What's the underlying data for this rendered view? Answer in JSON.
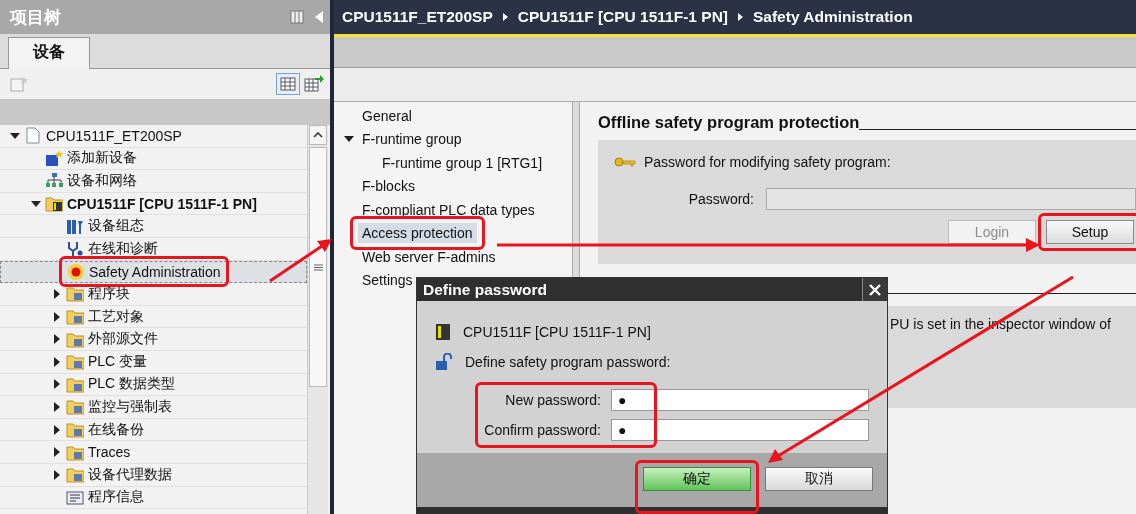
{
  "project_tree": {
    "title": "项目树",
    "tabs": [
      {
        "label": "设备",
        "selected": true
      }
    ],
    "items": [
      {
        "label": "CPU1511F_ET200SP",
        "kind": "project",
        "expanded": true,
        "selected": false,
        "highlighted": false,
        "children": [
          {
            "label": "添加新设备",
            "kind": "add",
            "selected": false,
            "highlighted": false
          },
          {
            "label": "设备和网络",
            "kind": "network",
            "selected": false,
            "highlighted": false
          },
          {
            "label": "CPU1511F [CPU 1511F-1 PN]",
            "kind": "plc",
            "bold": true,
            "expanded": true,
            "selected": false,
            "highlighted": false,
            "children": [
              {
                "label": "设备组态",
                "kind": "config",
                "selected": false,
                "highlighted": false
              },
              {
                "label": "在线和诊断",
                "kind": "diag",
                "selected": false,
                "highlighted": false
              },
              {
                "label": "Safety Administration",
                "kind": "safety",
                "selected": true,
                "highlighted": true
              },
              {
                "label": "程序块",
                "kind": "folder",
                "expanded": false,
                "selected": false,
                "highlighted": false
              },
              {
                "label": "工艺对象",
                "kind": "folder",
                "expanded": false,
                "selected": false,
                "highlighted": false
              },
              {
                "label": "外部源文件",
                "kind": "folder",
                "expanded": false,
                "selected": false,
                "highlighted": false
              },
              {
                "label": "PLC 变量",
                "kind": "folder",
                "expanded": false,
                "selected": false,
                "highlighted": false
              },
              {
                "label": "PLC 数据类型",
                "kind": "folder",
                "expanded": false,
                "selected": false,
                "highlighted": false
              },
              {
                "label": "监控与强制表",
                "kind": "folder",
                "expanded": false,
                "selected": false,
                "highlighted": false
              },
              {
                "label": "在线备份",
                "kind": "folder",
                "expanded": false,
                "selected": false,
                "highlighted": false
              },
              {
                "label": "Traces",
                "kind": "folder",
                "expanded": false,
                "selected": false,
                "highlighted": false
              },
              {
                "label": "设备代理数据",
                "kind": "folder",
                "expanded": false,
                "selected": false,
                "highlighted": false
              },
              {
                "label": "程序信息",
                "kind": "info",
                "selected": false,
                "highlighted": false
              }
            ]
          }
        ]
      }
    ]
  },
  "breadcrumb": [
    "CPU1511F_ET200SP",
    "CPU1511F [CPU 1511F-1 PN]",
    "Safety Administration"
  ],
  "nav": [
    {
      "label": "General",
      "selected": false,
      "highlighted": false
    },
    {
      "label": "F-runtime group",
      "expanded": true,
      "selected": false,
      "highlighted": false,
      "children": [
        {
          "label": "F-runtime group 1 [RTG1]",
          "selected": false,
          "highlighted": false
        }
      ]
    },
    {
      "label": "F-blocks",
      "selected": false,
      "highlighted": false
    },
    {
      "label": "F-compliant PLC data types",
      "selected": false,
      "highlighted": false
    },
    {
      "label": "Access protection",
      "selected": true,
      "highlighted": true
    },
    {
      "label": "Web server F-admins",
      "selected": false,
      "highlighted": false
    },
    {
      "label": "Settings",
      "selected": false,
      "highlighted": false
    }
  ],
  "section": {
    "title": "Offline safety program protection",
    "prompt": "Password for modifying safety program:",
    "password_label": "Password:",
    "buttons": [
      {
        "label": "Login",
        "disabled": true,
        "highlighted": false
      },
      {
        "label": "Setup",
        "disabled": false,
        "highlighted": true
      }
    ],
    "note": "PU is set in the inspector window of"
  },
  "dialog": {
    "title": "Define password",
    "device": "CPU1511F [CPU 1511F-1 PN]",
    "prompt": "Define safety program password:",
    "fields_highlighted": true,
    "fields": [
      {
        "label": "New password:",
        "value": "●"
      },
      {
        "label": "Confirm password:",
        "value": "●"
      }
    ],
    "buttons": [
      {
        "label": "确定",
        "kind": "primary",
        "highlighted": true
      },
      {
        "label": "取消",
        "kind": "secondary",
        "highlighted": false
      }
    ]
  }
}
